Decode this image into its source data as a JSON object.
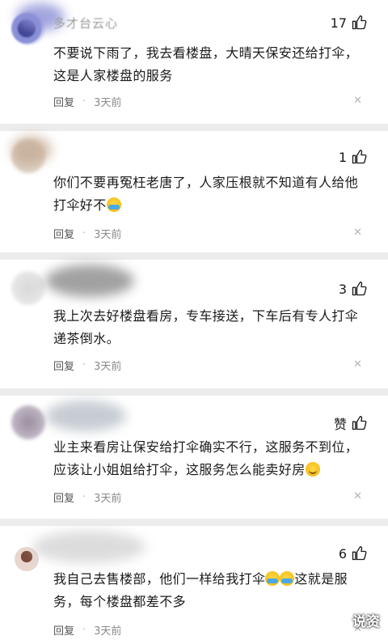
{
  "comments": [
    {
      "username": "多才台云心",
      "likes": "17",
      "lines": [
        "不要说下雨了，我去看楼盘，大晴天保安还给打伞，",
        "这是人家楼盘的服务"
      ],
      "reply_label": "回复",
      "time": "3天前"
    },
    {
      "username": "",
      "likes": "1",
      "lines": [
        "你们不要再冤枉老唐了，人家压根就不知道有人给他",
        "打伞好不"
      ],
      "reply_label": "回复",
      "time": "3天前"
    },
    {
      "username": "",
      "likes": "3",
      "lines": [
        "我上次去好楼盘看房，专车接送，下车后有专人打伞",
        "递茶倒水。"
      ],
      "reply_label": "回复",
      "time": "3天前"
    },
    {
      "username": "",
      "likes": "赞",
      "lines": [
        "业主来看房让保安给打伞确实不行，这服务不到位，",
        "应该让小姐姐给打伞，这服务怎么能卖好房"
      ],
      "reply_label": "回复",
      "time": "3天前"
    },
    {
      "username": "",
      "likes": "6",
      "lines": [
        "我自己去售楼部，他们一样给我打伞",
        "这就是服",
        "务，每个楼盘都差不多"
      ],
      "reply_label": "回复",
      "time": "3天前"
    }
  ],
  "watermark": "说资",
  "icons": {
    "like": "thumbs-up-icon",
    "close": "close-icon",
    "emoji_cry": "crying-laugh-emoji",
    "emoji_smile": "smile-emoji"
  }
}
